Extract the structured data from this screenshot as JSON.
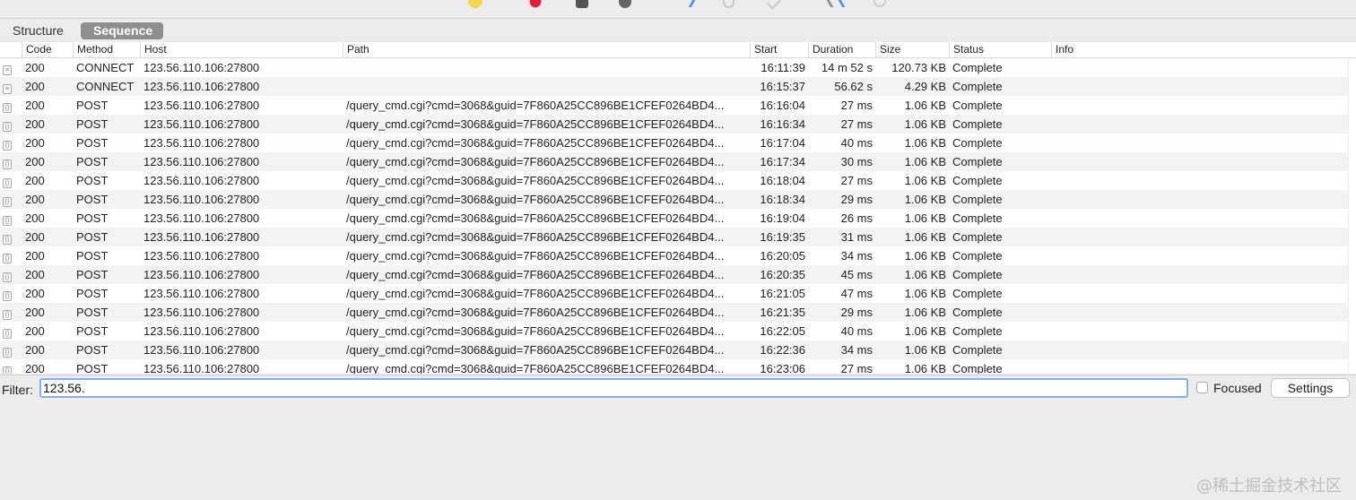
{
  "tabs": {
    "structure": "Structure",
    "sequence": "Sequence"
  },
  "columns": {
    "code": "Code",
    "method": "Method",
    "host": "Host",
    "path": "Path",
    "start": "Start",
    "duration": "Duration",
    "size": "Size",
    "status": "Status",
    "info": "Info"
  },
  "rows": [
    {
      "icon": "lock-icon",
      "code": "200",
      "method": "CONNECT",
      "host": "123.56.110.106:27800",
      "path": "",
      "start": "16:11:39",
      "duration": "14 m 52 s",
      "size": "120.73 KB",
      "status": "Complete",
      "info": ""
    },
    {
      "icon": "lock-icon",
      "code": "200",
      "method": "CONNECT",
      "host": "123.56.110.106:27800",
      "path": "",
      "start": "16:15:37",
      "duration": "56.62 s",
      "size": "4.29 KB",
      "status": "Complete",
      "info": ""
    },
    {
      "icon": "json-icon",
      "code": "200",
      "method": "POST",
      "host": "123.56.110.106:27800",
      "path": "/query_cmd.cgi?cmd=3068&guid=7F860A25CC896BE1CFEF0264BD4...",
      "start": "16:16:04",
      "duration": "27 ms",
      "size": "1.06 KB",
      "status": "Complete",
      "info": ""
    },
    {
      "icon": "json-icon",
      "code": "200",
      "method": "POST",
      "host": "123.56.110.106:27800",
      "path": "/query_cmd.cgi?cmd=3068&guid=7F860A25CC896BE1CFEF0264BD4...",
      "start": "16:16:34",
      "duration": "27 ms",
      "size": "1.06 KB",
      "status": "Complete",
      "info": ""
    },
    {
      "icon": "json-icon",
      "code": "200",
      "method": "POST",
      "host": "123.56.110.106:27800",
      "path": "/query_cmd.cgi?cmd=3068&guid=7F860A25CC896BE1CFEF0264BD4...",
      "start": "16:17:04",
      "duration": "40 ms",
      "size": "1.06 KB",
      "status": "Complete",
      "info": ""
    },
    {
      "icon": "json-icon",
      "code": "200",
      "method": "POST",
      "host": "123.56.110.106:27800",
      "path": "/query_cmd.cgi?cmd=3068&guid=7F860A25CC896BE1CFEF0264BD4...",
      "start": "16:17:34",
      "duration": "30 ms",
      "size": "1.06 KB",
      "status": "Complete",
      "info": ""
    },
    {
      "icon": "json-icon",
      "code": "200",
      "method": "POST",
      "host": "123.56.110.106:27800",
      "path": "/query_cmd.cgi?cmd=3068&guid=7F860A25CC896BE1CFEF0264BD4...",
      "start": "16:18:04",
      "duration": "27 ms",
      "size": "1.06 KB",
      "status": "Complete",
      "info": ""
    },
    {
      "icon": "json-icon",
      "code": "200",
      "method": "POST",
      "host": "123.56.110.106:27800",
      "path": "/query_cmd.cgi?cmd=3068&guid=7F860A25CC896BE1CFEF0264BD4...",
      "start": "16:18:34",
      "duration": "29 ms",
      "size": "1.06 KB",
      "status": "Complete",
      "info": ""
    },
    {
      "icon": "json-icon",
      "code": "200",
      "method": "POST",
      "host": "123.56.110.106:27800",
      "path": "/query_cmd.cgi?cmd=3068&guid=7F860A25CC896BE1CFEF0264BD4...",
      "start": "16:19:04",
      "duration": "26 ms",
      "size": "1.06 KB",
      "status": "Complete",
      "info": ""
    },
    {
      "icon": "json-icon",
      "code": "200",
      "method": "POST",
      "host": "123.56.110.106:27800",
      "path": "/query_cmd.cgi?cmd=3068&guid=7F860A25CC896BE1CFEF0264BD4...",
      "start": "16:19:35",
      "duration": "31 ms",
      "size": "1.06 KB",
      "status": "Complete",
      "info": ""
    },
    {
      "icon": "json-icon",
      "code": "200",
      "method": "POST",
      "host": "123.56.110.106:27800",
      "path": "/query_cmd.cgi?cmd=3068&guid=7F860A25CC896BE1CFEF0264BD4...",
      "start": "16:20:05",
      "duration": "34 ms",
      "size": "1.06 KB",
      "status": "Complete",
      "info": ""
    },
    {
      "icon": "json-icon",
      "code": "200",
      "method": "POST",
      "host": "123.56.110.106:27800",
      "path": "/query_cmd.cgi?cmd=3068&guid=7F860A25CC896BE1CFEF0264BD4...",
      "start": "16:20:35",
      "duration": "45 ms",
      "size": "1.06 KB",
      "status": "Complete",
      "info": ""
    },
    {
      "icon": "json-icon",
      "code": "200",
      "method": "POST",
      "host": "123.56.110.106:27800",
      "path": "/query_cmd.cgi?cmd=3068&guid=7F860A25CC896BE1CFEF0264BD4...",
      "start": "16:21:05",
      "duration": "47 ms",
      "size": "1.06 KB",
      "status": "Complete",
      "info": ""
    },
    {
      "icon": "json-icon",
      "code": "200",
      "method": "POST",
      "host": "123.56.110.106:27800",
      "path": "/query_cmd.cgi?cmd=3068&guid=7F860A25CC896BE1CFEF0264BD4...",
      "start": "16:21:35",
      "duration": "29 ms",
      "size": "1.06 KB",
      "status": "Complete",
      "info": ""
    },
    {
      "icon": "json-icon",
      "code": "200",
      "method": "POST",
      "host": "123.56.110.106:27800",
      "path": "/query_cmd.cgi?cmd=3068&guid=7F860A25CC896BE1CFEF0264BD4...",
      "start": "16:22:05",
      "duration": "40 ms",
      "size": "1.06 KB",
      "status": "Complete",
      "info": ""
    },
    {
      "icon": "json-icon",
      "code": "200",
      "method": "POST",
      "host": "123.56.110.106:27800",
      "path": "/query_cmd.cgi?cmd=3068&guid=7F860A25CC896BE1CFEF0264BD4...",
      "start": "16:22:36",
      "duration": "34 ms",
      "size": "1.06 KB",
      "status": "Complete",
      "info": ""
    },
    {
      "icon": "json-icon",
      "code": "200",
      "method": "POST",
      "host": "123.56.110.106:27800",
      "path": "/query_cmd.cgi?cmd=3068&guid=7F860A25CC896BE1CFEF0264BD4...",
      "start": "16:23:06",
      "duration": "27 ms",
      "size": "1.06 KB",
      "status": "Complete",
      "info": ""
    }
  ],
  "filter": {
    "label": "Filter:",
    "value": "123.56."
  },
  "focused": {
    "label": "Focused",
    "checked": false
  },
  "settings": {
    "label": "Settings"
  },
  "watermark": "@稀土掘金技术社区",
  "colors": {
    "accent": "#7fb0f2",
    "tab_selected": "#8f8f8f",
    "record": "#e8183a"
  }
}
